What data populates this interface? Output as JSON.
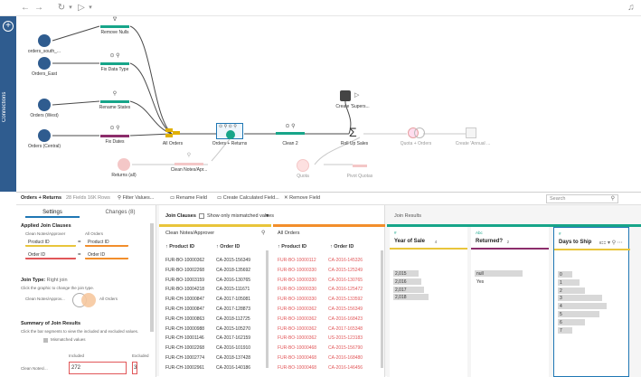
{
  "canvas": {
    "nodes": [
      {
        "label": "orders_south_..."
      },
      {
        "label": "Orders_East"
      },
      {
        "label": "Orders (West)"
      },
      {
        "label": "Orders (Central)"
      },
      {
        "label": "Returns (all)"
      }
    ],
    "cleans": [
      {
        "label": "Remove Nulls"
      },
      {
        "label": "Fix Data Type"
      },
      {
        "label": "Rename States"
      },
      {
        "label": "Fix Dates"
      },
      {
        "label": "Clean Notes/Apr..."
      }
    ],
    "all_orders": "All Orders",
    "join": "Orders + Returns",
    "clean2": "Clean 2",
    "rollup": "Roll Up Sales",
    "output": "Create 'Supers...",
    "quota_orders": "Quota + Orders",
    "create_annual": "Create 'Annual ...",
    "quota": "Quota",
    "pivot_quotas": "Pivot Quotas"
  },
  "left_strip": {
    "label": "Connections"
  },
  "panel": {
    "title": "Orders + Returns",
    "meta": "28 Fields  16K Rows",
    "filter": "Filter Values...",
    "rename": "Rename Field",
    "create_calc": "Create Calculated Field...",
    "remove": "Remove Field",
    "search_placeholder": "Search"
  },
  "settings": {
    "tab_settings": "Settings",
    "tab_changes": "Changes (8)",
    "applied_title": "Applied Join Clauses",
    "left_src": "Clean Notes/Approver",
    "right_src": "All Orders",
    "clause1_left": "Product ID",
    "clause1_op": "=",
    "clause1_right": "Product ID",
    "clause2_left": "Order ID",
    "clause2_op": "=",
    "clause2_right": "Order ID",
    "join_type_label": "Join Type:",
    "join_type_value": "Right join",
    "join_type_hint": "Click the graphic to change the join type.",
    "venn_left": "Clean Notes/Approv...",
    "venn_right": "All Orders",
    "summary_title": "Summary of Join Results",
    "summary_hint": "Click the bar segments to view the included and excluded values.",
    "mismatched": "Mismatched values",
    "included": "Included",
    "excluded": "Excluded",
    "row_label": "Clean Notes/...",
    "included_count": "272",
    "excluded_count": "3"
  },
  "join_clauses": {
    "title": "Join Clauses",
    "show_label": "Show only mismatched values",
    "left_source": "Clean Notes/Approver",
    "right_source": "All Orders",
    "col_product": "Product ID",
    "col_order": "Order ID",
    "left_rows": [
      [
        "FUR-BO-10000362",
        "CA-2015-156349"
      ],
      [
        "FUR-BO-10002268",
        "CA-2018-135692"
      ],
      [
        "FUR-BO-10003159",
        "CA-2016-130765"
      ],
      [
        "FUR-BO-10004218",
        "CA-2015-111671"
      ],
      [
        "FUR-CH-10000847",
        "CA-2017-105081"
      ],
      [
        "FUR-CH-10000847",
        "CA-2017-128873"
      ],
      [
        "FUR-CH-10000863",
        "CA-2018-112725"
      ],
      [
        "FUR-CH-10000988",
        "CA-2015-105270"
      ],
      [
        "FUR-CH-10001146",
        "CA-2017-162159"
      ],
      [
        "FUR-CH-10002268",
        "CA-2016-101910"
      ],
      [
        "FUR-CH-10002774",
        "CA-2018-137428"
      ],
      [
        "FUR-CH-10002961",
        "CA-2016-140186"
      ]
    ],
    "right_rows": [
      [
        "FUR-BO-10000112",
        "CA-2016-145326"
      ],
      [
        "FUR-BO-10000330",
        "CA-2015-125249"
      ],
      [
        "FUR-BO-10000330",
        "CA-2016-130765"
      ],
      [
        "FUR-BO-10000330",
        "CA-2016-125472"
      ],
      [
        "FUR-BO-10000330",
        "CA-2015-133592"
      ],
      [
        "FUR-BO-10000362",
        "CA-2015-156349"
      ],
      [
        "FUR-BO-10000362",
        "CA-2016-168423"
      ],
      [
        "FUR-BO-10000362",
        "CA-2017-165348"
      ],
      [
        "FUR-BO-10000362",
        "US-2015-123183"
      ],
      [
        "FUR-BO-10000468",
        "CA-2015-156790"
      ],
      [
        "FUR-BO-10000468",
        "CA-2016-168480"
      ],
      [
        "FUR-BO-10000468",
        "CA-2016-146456"
      ]
    ]
  },
  "join_results": {
    "title": "Join Results",
    "cards": [
      {
        "type": "#",
        "name": "Year of Sale",
        "count": "4",
        "values": [
          "2,015",
          "2,016",
          "2,017",
          "2,018"
        ],
        "fractions": [
          0.5,
          0.55,
          0.6,
          0.7
        ]
      },
      {
        "type": "Abc",
        "name": "Returned?",
        "count": "2",
        "values": [
          "null",
          "Yes"
        ],
        "fractions": [
          0.95,
          0.0
        ]
      },
      {
        "type": "#",
        "name": "Days to Ship",
        "count": "8",
        "values": [
          "0",
          "1",
          "2",
          "3",
          "4",
          "5",
          "6",
          "7"
        ],
        "fractions": [
          0.3,
          0.45,
          0.55,
          0.9,
          1.0,
          0.85,
          0.55,
          0.3
        ]
      }
    ]
  },
  "colors": {
    "blue": "#2f5c8f",
    "accent": "#1f77b4",
    "clean_green": "#17a589",
    "clean_purple": "#8c2d6b",
    "orange": "#f28e2b",
    "red_value": "#e15759"
  }
}
